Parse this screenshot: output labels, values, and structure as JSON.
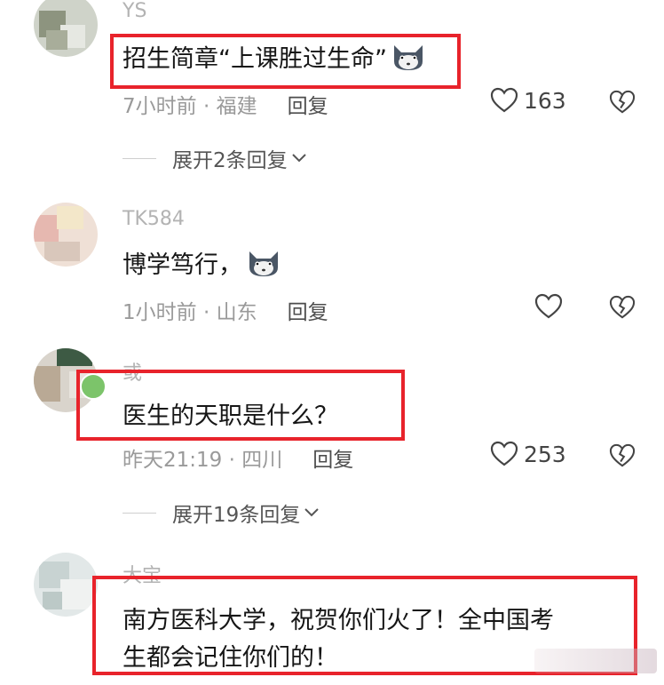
{
  "comments": [
    {
      "username": "YS",
      "text": "招生简章“上课胜过生命”",
      "time": "7小时前",
      "location": "福建",
      "reply_label": "回复",
      "likes": "163",
      "expand": "展开2条回复"
    },
    {
      "username": "TK584",
      "text": "博学笃行，",
      "time": "1小时前",
      "location": "山东",
      "reply_label": "回复",
      "likes": ""
    },
    {
      "username": "或",
      "text": "医生的天职是什么？",
      "time": "昨天21:19",
      "location": "四川",
      "reply_label": "回复",
      "likes": "253",
      "expand": "展开19条回复"
    },
    {
      "username": "大宝",
      "text_line1": "南方医科大学，祝贺你们火了！全中国考",
      "text_line2": "生都会记住你们的！"
    }
  ],
  "separator": " · ",
  "colors": {
    "highlight_border": "#e8232b",
    "meta_gray": "#9a9a9a"
  },
  "icons": [
    "heart-outline-icon",
    "broken-heart-icon",
    "chevron-down-icon",
    "cat-face-emoji-icon"
  ]
}
